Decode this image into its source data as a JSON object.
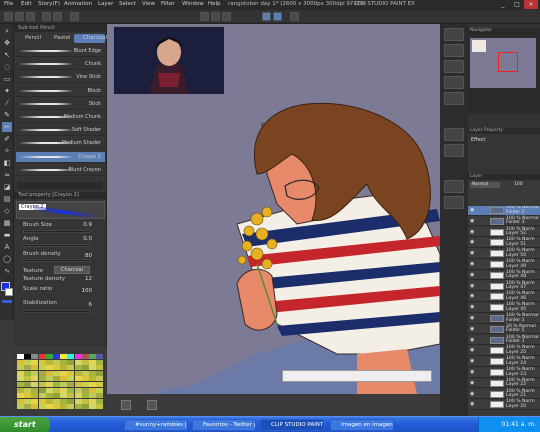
{
  "window": {
    "doc_title": "rangotober day 1* (2600 x 3000px 300dpi 97.0%)",
    "app_name": "- CLIP STUDIO PAINT EX",
    "controls": [
      "_",
      "□",
      "✕"
    ]
  },
  "menu": [
    "File",
    "Edit",
    "Story(F)",
    "Animation",
    "Layer",
    "Select",
    "View",
    "Filter",
    "Window",
    "Help"
  ],
  "subtool": {
    "header": "Sub tool Pencil",
    "tabs": [
      "Pencil",
      "Pastel",
      "Charcoal"
    ],
    "brushes": [
      "Blunt Edge",
      "Chunk",
      "Vine Stick",
      "Block",
      "Stick",
      "Medium Chunk",
      "Soft Shader",
      "Medium Shader",
      "Crayon 2",
      "Blunt Crayon"
    ],
    "selected_index": 8
  },
  "tool_property": {
    "header": "Tool property [Crayon 2]",
    "tool_name": "Crayon 2",
    "brush_size_label": "Brush Size",
    "brush_size": "0.9",
    "angle_label": "Angle",
    "angle": "0.0",
    "brush_density_label": "Brush density",
    "brush_density": "80",
    "texture_label": "Texture",
    "texture_value": "Charcoal",
    "texture_density_label": "Texture density",
    "texture_density": "12",
    "scale_ratio_label": "Scale ratio",
    "scale_ratio": "100",
    "stabilization_label": "Stabilization",
    "stabilization": "6"
  },
  "canvas": {
    "background": "#7d7a95"
  },
  "right": {
    "navigator_header": "Navigator",
    "layer_property_header": "Layer Property",
    "effect_label": "Effect",
    "layer_header": "Layer",
    "blend": "Normal",
    "opacity": "100"
  },
  "layers": [
    {
      "pct": "100 % Normal",
      "name": "Folder 2"
    },
    {
      "pct": "100 % Normal",
      "name": "Folder 3"
    },
    {
      "pct": "100 % Norm",
      "name": "Layer 52"
    },
    {
      "pct": "100 % Norm",
      "name": "Layer 51"
    },
    {
      "pct": "100 % Norm",
      "name": "Layer 50"
    },
    {
      "pct": "100 % Norm",
      "name": "Layer 49"
    },
    {
      "pct": "100 % Norm",
      "name": "Layer 48"
    },
    {
      "pct": "100 % Norm",
      "name": "Layer 47"
    },
    {
      "pct": "100 % Norm",
      "name": "Layer 46"
    },
    {
      "pct": "100 % Norm",
      "name": "Layer 45"
    },
    {
      "pct": "100 % Normal",
      "name": "Folder 1"
    },
    {
      "pct": "20 % Normal",
      "name": "Folder 5"
    },
    {
      "pct": "100 % Normal",
      "name": "Folder 1"
    },
    {
      "pct": "100 % Norm",
      "name": "Layer 25"
    },
    {
      "pct": "100 % Norm",
      "name": "Layer 24"
    },
    {
      "pct": "100 % Norm",
      "name": "Layer 23"
    },
    {
      "pct": "100 % Norm",
      "name": "Layer 22"
    },
    {
      "pct": "100 % Norm",
      "name": "Layer 21"
    },
    {
      "pct": "100 % Norm",
      "name": "Layer 20"
    }
  ],
  "taskbar": {
    "start": "start",
    "tasks": [
      "#sunny+rambles | PO...",
      "Favoritos - Twitter y 6...",
      "CLIP STUDIO PAINT",
      "Imagen en imagen"
    ],
    "clock": "01:41 a. m."
  }
}
